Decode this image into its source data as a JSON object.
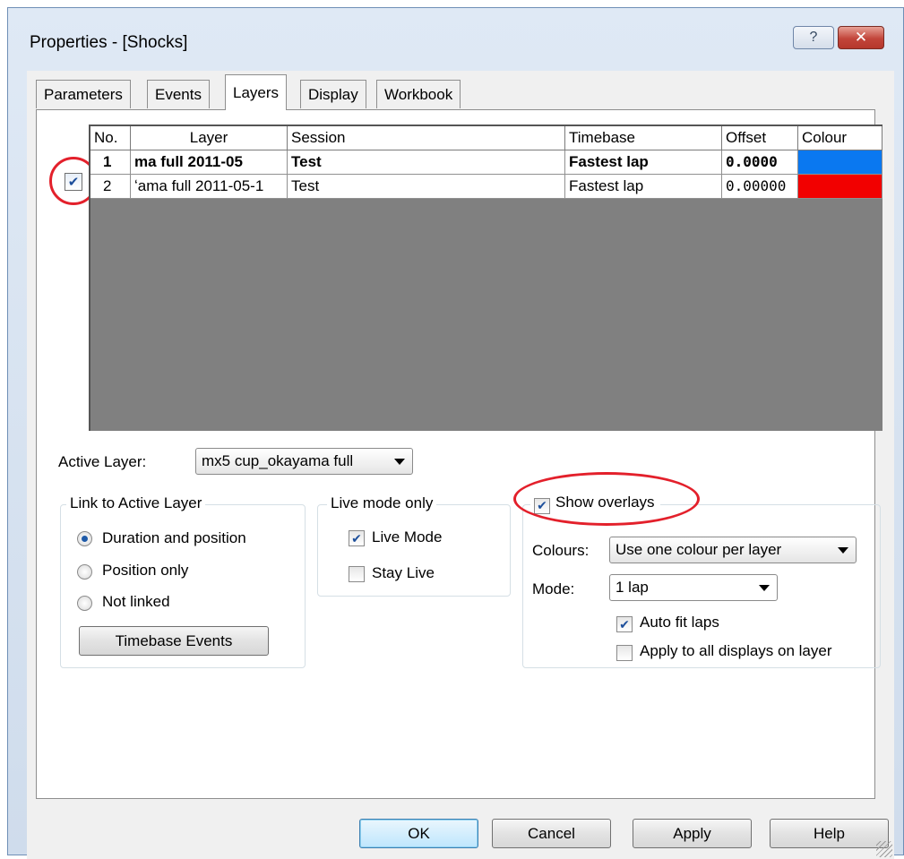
{
  "window": {
    "title": "Properties - [Shocks]",
    "help_glyph": "?",
    "close_glyph": "✕"
  },
  "tabs": [
    {
      "label": "Parameters"
    },
    {
      "label": "Events"
    },
    {
      "label": "Layers"
    },
    {
      "label": "Display"
    },
    {
      "label": "Workbook"
    }
  ],
  "grid": {
    "headers": [
      "No.",
      "Layer",
      "Session",
      "Timebase",
      "Offset",
      "Colour"
    ],
    "rows": [
      {
        "no": "1",
        "layer": "ma full 2011-05",
        "session": "Test",
        "timebase": "Fastest lap",
        "offset": "0.0000",
        "colour": "#0a78f0",
        "checked": false
      },
      {
        "no": "2",
        "layer": "ʻama full 2011-05-1",
        "session": "Test",
        "timebase": "Fastest lap",
        "offset": "0.00000",
        "colour": "#f20000",
        "checked": true
      }
    ],
    "check_glyph": "✔"
  },
  "active_layer": {
    "label": "Active Layer:",
    "value": "mx5 cup_okayama full"
  },
  "link_group": {
    "title": "Link to Active Layer",
    "options": [
      "Duration and position",
      "Position only",
      "Not linked"
    ],
    "selected": "Duration and position",
    "button": "Timebase Events"
  },
  "live_group": {
    "title": "Live mode only",
    "live_mode": {
      "label": "Live Mode",
      "checked": true
    },
    "stay_live": {
      "label": "Stay Live",
      "checked": false
    }
  },
  "overlay_group": {
    "show_overlays": {
      "label": "Show overlays",
      "checked": true
    },
    "colours_label": "Colours:",
    "colours_value": "Use one colour per layer",
    "mode_label": "Mode:",
    "mode_value": "1 lap",
    "auto_fit": {
      "label": "Auto fit laps",
      "checked": true
    },
    "apply_all": {
      "label": "Apply to all displays on layer",
      "checked": false
    }
  },
  "footer": {
    "ok": "OK",
    "cancel": "Cancel",
    "apply": "Apply",
    "help": "Help"
  },
  "colors": {
    "annotation_red": "#e3202b",
    "grid_background": "#808080"
  }
}
